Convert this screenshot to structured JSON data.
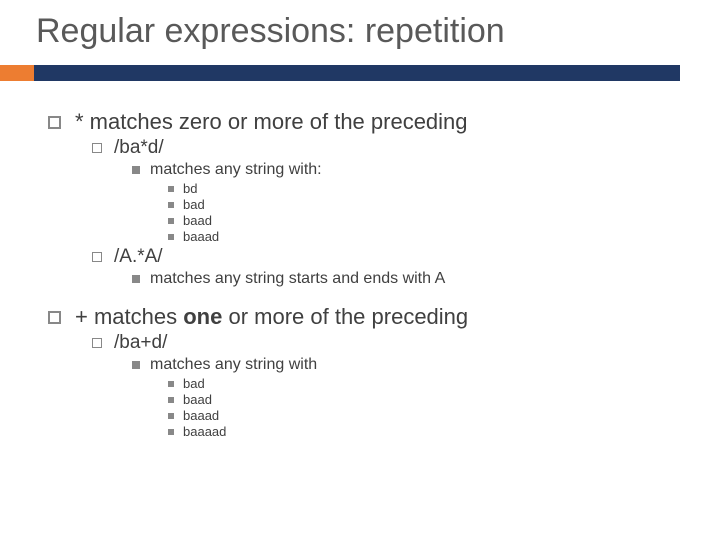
{
  "title": "Regular expressions: repetition",
  "sec1": {
    "heading": "* matches zero or more of the preceding",
    "ex1": {
      "pattern": "/ba*d/",
      "desc": "matches any string with:",
      "items": [
        "bd",
        "bad",
        "baad",
        "baaad"
      ]
    },
    "ex2": {
      "pattern": "/A.*A/",
      "desc": "matches any string starts and ends with A"
    }
  },
  "sec2": {
    "heading_pre": "+ matches ",
    "heading_bold": "one",
    "heading_post": " or more of the preceding",
    "ex1": {
      "pattern": "/ba+d/",
      "desc": "matches any string with",
      "items": [
        "bad",
        "baad",
        "baaad",
        "baaaad"
      ]
    }
  }
}
